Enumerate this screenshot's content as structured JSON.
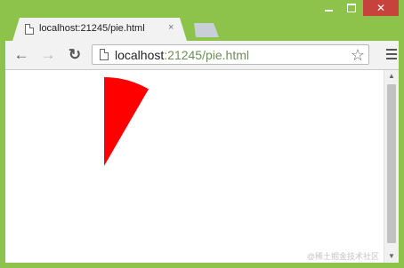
{
  "tab": {
    "title": "localhost:21245/pie.html",
    "close_glyph": "×",
    "icon": "page-icon"
  },
  "window_controls": {
    "minimize_icon": "minimize-icon",
    "maximize_icon": "maximize-icon",
    "close_glyph": "✕"
  },
  "toolbar": {
    "back_glyph": "←",
    "forward_glyph": "→",
    "reload_glyph": "↻",
    "url_host": "localhost",
    "url_rest": ":21245/pie.html",
    "star_glyph": "☆",
    "menu_icon": "hamburger-menu-icon"
  },
  "page": {
    "shape": "pie-slice",
    "fill_color": "#ff0000",
    "slice_start_deg": 0,
    "slice_end_deg": 30
  },
  "scrollbar": {
    "up_glyph": "▲",
    "down_glyph": "▼"
  },
  "watermark": "@稀土掘金技术社区",
  "colors": {
    "frame": "#8dc34a",
    "close_button": "#c7423c",
    "tab": "#f2f2f2",
    "url_path": "#6e8e57"
  }
}
